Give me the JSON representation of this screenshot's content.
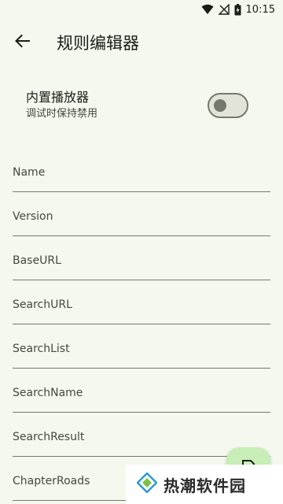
{
  "status_bar": {
    "time": "10:15"
  },
  "app_bar": {
    "title": "规则编辑器"
  },
  "preference": {
    "title": "内置播放器",
    "summary": "调试时保持禁用",
    "enabled": false
  },
  "fields": [
    {
      "placeholder": "Name",
      "value": ""
    },
    {
      "placeholder": "Version",
      "value": ""
    },
    {
      "placeholder": "BaseURL",
      "value": ""
    },
    {
      "placeholder": "SearchURL",
      "value": ""
    },
    {
      "placeholder": "SearchList",
      "value": ""
    },
    {
      "placeholder": "SearchName",
      "value": ""
    },
    {
      "placeholder": "SearchResult",
      "value": ""
    },
    {
      "placeholder": "ChapterRoads",
      "value": ""
    }
  ],
  "watermark": {
    "text": "热潮软件园"
  },
  "colors": {
    "background": "#f4f8ee",
    "fab": "#c7eeb6",
    "outline": "#74796c"
  },
  "icons": {
    "back": "arrow-back-icon",
    "wifi": "wifi-icon",
    "signal": "no-signal-icon",
    "battery": "battery-charging-icon",
    "fab": "save-icon"
  }
}
